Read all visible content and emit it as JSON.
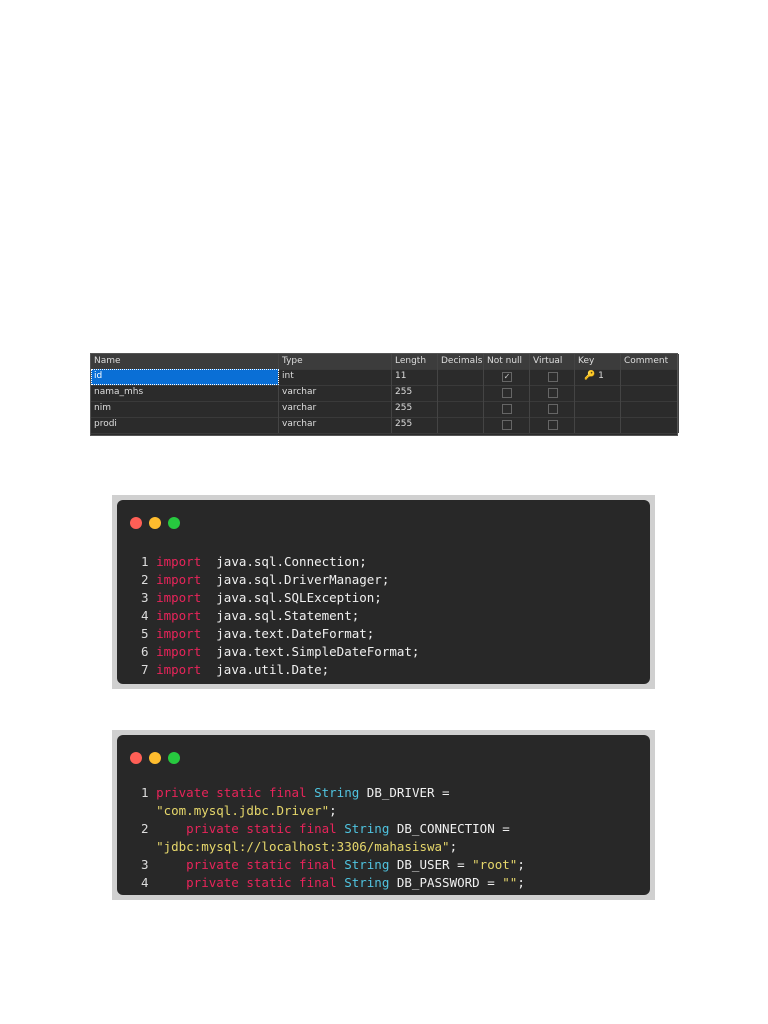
{
  "table": {
    "columns": [
      "Name",
      "Type",
      "Length",
      "Decimals",
      "Not null",
      "Virtual",
      "Key",
      "Comment"
    ],
    "rows": [
      {
        "name": "id",
        "type": "int",
        "length": "11",
        "decimals": "",
        "not_null": true,
        "virtual": false,
        "key": "1",
        "comment": ""
      },
      {
        "name": "nama_mhs",
        "type": "varchar",
        "length": "255",
        "decimals": "",
        "not_null": false,
        "virtual": false,
        "key": "",
        "comment": ""
      },
      {
        "name": "nim",
        "type": "varchar",
        "length": "255",
        "decimals": "",
        "not_null": false,
        "virtual": false,
        "key": "",
        "comment": ""
      },
      {
        "name": "prodi",
        "type": "varchar",
        "length": "255",
        "decimals": "",
        "not_null": false,
        "virtual": false,
        "key": "",
        "comment": ""
      }
    ]
  },
  "code1": [
    [
      [
        "ln",
        "1 "
      ],
      [
        "kw",
        "import"
      ],
      [
        "",
        "  java.sql.Connection;"
      ]
    ],
    [
      [
        "ln",
        "2 "
      ],
      [
        "kw",
        "import"
      ],
      [
        "",
        "  java.sql.DriverManager;"
      ]
    ],
    [
      [
        "ln",
        "3 "
      ],
      [
        "kw",
        "import"
      ],
      [
        "",
        "  java.sql.SQLException;"
      ]
    ],
    [
      [
        "ln",
        "4 "
      ],
      [
        "kw",
        "import"
      ],
      [
        "",
        "  java.sql.Statement;"
      ]
    ],
    [
      [
        "ln",
        "5 "
      ],
      [
        "kw",
        "import"
      ],
      [
        "",
        "  java.text.DateFormat;"
      ]
    ],
    [
      [
        "ln",
        "6 "
      ],
      [
        "kw",
        "import"
      ],
      [
        "",
        "  java.text.SimpleDateFormat;"
      ]
    ],
    [
      [
        "ln",
        "7 "
      ],
      [
        "kw",
        "import"
      ],
      [
        "",
        "  java.util.Date;"
      ]
    ]
  ],
  "code2": [
    [
      [
        "ln",
        "1 "
      ],
      [
        "kw",
        "private static final "
      ],
      [
        "ty",
        "String"
      ],
      [
        "",
        " DB_DRIVER ="
      ]
    ],
    [
      [
        "",
        "  "
      ],
      [
        "st",
        "\"com.mysql.jdbc.Driver\""
      ],
      [
        "",
        ";"
      ]
    ],
    [
      [
        "ln",
        "2     "
      ],
      [
        "kw",
        "private static final "
      ],
      [
        "ty",
        "String"
      ],
      [
        "",
        " DB_CONNECTION ="
      ]
    ],
    [
      [
        "",
        "  "
      ],
      [
        "st",
        "\"jdbc:mysql://localhost:3306/mahasiswa\""
      ],
      [
        "",
        ";"
      ]
    ],
    [
      [
        "ln",
        "3     "
      ],
      [
        "kw",
        "private static final "
      ],
      [
        "ty",
        "String"
      ],
      [
        "",
        " DB_USER = "
      ],
      [
        "st",
        "\"root\""
      ],
      [
        "",
        ";"
      ]
    ],
    [
      [
        "ln",
        "4     "
      ],
      [
        "kw",
        "private static final "
      ],
      [
        "ty",
        "String"
      ],
      [
        "",
        " DB_PASSWORD = "
      ],
      [
        "st",
        "\"\""
      ],
      [
        "",
        ";"
      ]
    ]
  ],
  "colors": {
    "keyword": "#e8245a",
    "type": "#4fc4e0",
    "string": "#e6d76b",
    "bg": "#282828"
  }
}
